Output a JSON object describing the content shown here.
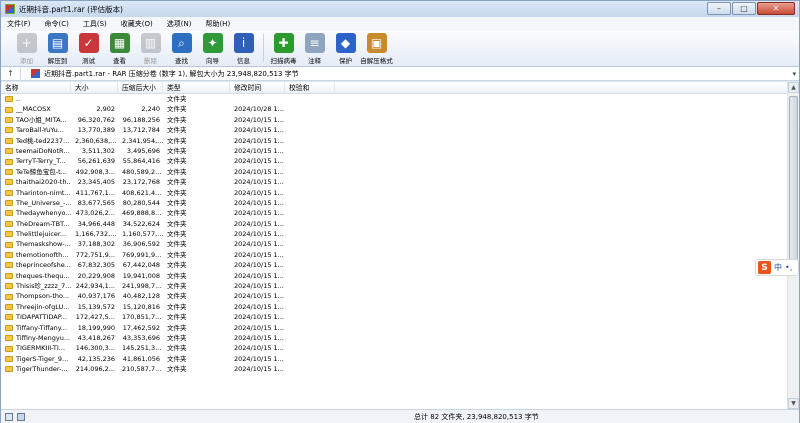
{
  "window": {
    "title": "近期抖音.part1.rar (评估版本)"
  },
  "menu": [
    "文件(F)",
    "命令(C)",
    "工具(S)",
    "收藏夹(O)",
    "选项(N)",
    "帮助(H)"
  ],
  "toolbar": [
    {
      "label": "添加",
      "icon": "add-icon",
      "color": "#8a8f96",
      "disabled": true
    },
    {
      "label": "解压到",
      "icon": "extract-folder-icon",
      "color": "#3b78c4",
      "disabled": false
    },
    {
      "label": "测试",
      "icon": "test-icon",
      "color": "#c9373a",
      "disabled": false
    },
    {
      "label": "查看",
      "icon": "view-book-icon",
      "color": "#3a8a3a",
      "disabled": false
    },
    {
      "label": "删除",
      "icon": "trash-icon",
      "color": "#8a8f96",
      "disabled": true
    },
    {
      "label": "查找",
      "icon": "magnifier-icon",
      "color": "#2c6fc0",
      "disabled": false
    },
    {
      "label": "向导",
      "icon": "wand-icon",
      "color": "#2f9a3a",
      "disabled": false
    },
    {
      "label": "信息",
      "icon": "info-icon",
      "color": "#2f5fb8",
      "disabled": false
    },
    {
      "label": "扫描病毒",
      "icon": "virus-scan-icon",
      "color": "#2d9a2d",
      "disabled": false
    },
    {
      "label": "注释",
      "icon": "comment-icon",
      "color": "#8fa4bf",
      "disabled": false
    },
    {
      "label": "保护",
      "icon": "shield-icon",
      "color": "#2d62c9",
      "disabled": false
    },
    {
      "label": "自解压格式",
      "icon": "sfx-icon",
      "color": "#c88a2c",
      "disabled": false
    }
  ],
  "pathbar": {
    "text": "近期抖音.part1.rar - RAR 压缩分卷 (数字 1), 解包大小为 23,948,820,513 字节"
  },
  "columns": [
    "名称",
    "大小",
    "压缩后大小",
    "类型",
    "修改时间",
    "校验和"
  ],
  "rows": [
    {
      "name": "..",
      "size": "",
      "packed": "",
      "type": "文件夹",
      "modified": ""
    },
    {
      "name": "__MACOSX",
      "size": "2,902",
      "packed": "2,240",
      "type": "文件夹",
      "modified": "2024/10/28 1..."
    },
    {
      "name": "TAO小姐_MITA...",
      "size": "96,320,762",
      "packed": "96,188,256",
      "type": "文件夹",
      "modified": "2024/10/15 1..."
    },
    {
      "name": "TaroBall-YuYu...",
      "size": "13,770,389",
      "packed": "13,712,784",
      "type": "文件夹",
      "modified": "2024/10/15 1..."
    },
    {
      "name": "Ted桃-ted2237...",
      "size": "2,360,638,...",
      "packed": "2,341,954,...",
      "type": "文件夹",
      "modified": "2024/10/15 1..."
    },
    {
      "name": "teemaiDoNotR...",
      "size": "3,511,302",
      "packed": "3,495,696",
      "type": "文件夹",
      "modified": "2024/10/15 1..."
    },
    {
      "name": "TerryT-Terry_T...",
      "size": "56,261,639",
      "packed": "55,864,416",
      "type": "文件夹",
      "modified": "2024/10/15 1..."
    },
    {
      "name": "TeTe鲸鱼宝包-t...",
      "size": "492,908,3...",
      "packed": "480,589,2...",
      "type": "文件夹",
      "modified": "2024/10/15 1..."
    },
    {
      "name": "thaithai2020-th...",
      "size": "23,345,405",
      "packed": "23,172,768",
      "type": "文件夹",
      "modified": "2024/10/15 1..."
    },
    {
      "name": "Tharinton-nimt...",
      "size": "411,767,1...",
      "packed": "408,621,4...",
      "type": "文件夹",
      "modified": "2024/10/15 1..."
    },
    {
      "name": "The_Universe_-...",
      "size": "83,677,565",
      "packed": "80,280,544",
      "type": "文件夹",
      "modified": "2024/10/15 1..."
    },
    {
      "name": "Thedaywhenyo...",
      "size": "473,026,2...",
      "packed": "469,888,8...",
      "type": "文件夹",
      "modified": "2024/10/15 1..."
    },
    {
      "name": "TheDream-TBT...",
      "size": "34,966,448",
      "packed": "34,522,624",
      "type": "文件夹",
      "modified": "2024/10/15 1..."
    },
    {
      "name": "Thelittlejuicer...",
      "size": "1,166,732,...",
      "packed": "1,160,577,...",
      "type": "文件夹",
      "modified": "2024/10/15 1..."
    },
    {
      "name": "Themaskshow-...",
      "size": "37,188,302",
      "packed": "36,906,592",
      "type": "文件夹",
      "modified": "2024/10/15 1..."
    },
    {
      "name": "themotionofth...",
      "size": "772,751,9...",
      "packed": "769,991,9...",
      "type": "文件夹",
      "modified": "2024/10/15 1..."
    },
    {
      "name": "theprinceofshe...",
      "size": "67,832,305",
      "packed": "67,442,048",
      "type": "文件夹",
      "modified": "2024/10/15 1..."
    },
    {
      "name": "theques-thequ...",
      "size": "20,229,908",
      "packed": "19,941,008",
      "type": "文件夹",
      "modified": "2024/10/15 1..."
    },
    {
      "name": "Thisis珍_zzzz_7...",
      "size": "242,934,1...",
      "packed": "241,998,7...",
      "type": "文件夹",
      "modified": "2024/10/15 1..."
    },
    {
      "name": "Thompson-tho...",
      "size": "40,937,176",
      "packed": "40,482,128",
      "type": "文件夹",
      "modified": "2024/10/15 1..."
    },
    {
      "name": "Threejin-ofgLU...",
      "size": "15,139,572",
      "packed": "15,120,816",
      "type": "文件夹",
      "modified": "2024/10/15 1..."
    },
    {
      "name": "TIDAPATTIDAP...",
      "size": "172,427,5...",
      "packed": "170,851,7...",
      "type": "文件夹",
      "modified": "2024/10/15 1..."
    },
    {
      "name": "Tiffany-Tiffany...",
      "size": "18,199,990",
      "packed": "17,462,592",
      "type": "文件夹",
      "modified": "2024/10/15 1..."
    },
    {
      "name": "Tiffiny-Mengyu...",
      "size": "43,418,267",
      "packed": "43,353,696",
      "type": "文件夹",
      "modified": "2024/10/15 1..."
    },
    {
      "name": "TIGERMKIII-TI...",
      "size": "146,300,3...",
      "packed": "145,251,3...",
      "type": "文件夹",
      "modified": "2024/10/15 1..."
    },
    {
      "name": "TigerS-Tiger_9...",
      "size": "42,135,236",
      "packed": "41,861,056",
      "type": "文件夹",
      "modified": "2024/10/15 1..."
    },
    {
      "name": "TigerThunder-...",
      "size": "214,096,2...",
      "packed": "210,587,7...",
      "type": "文件夹",
      "modified": "2024/10/15 1..."
    }
  ],
  "status": {
    "text": "总计 82 文件夹, 23,948,820,513 字节"
  },
  "ime": {
    "logo": "S",
    "lang": "中",
    "extra": "•,"
  }
}
